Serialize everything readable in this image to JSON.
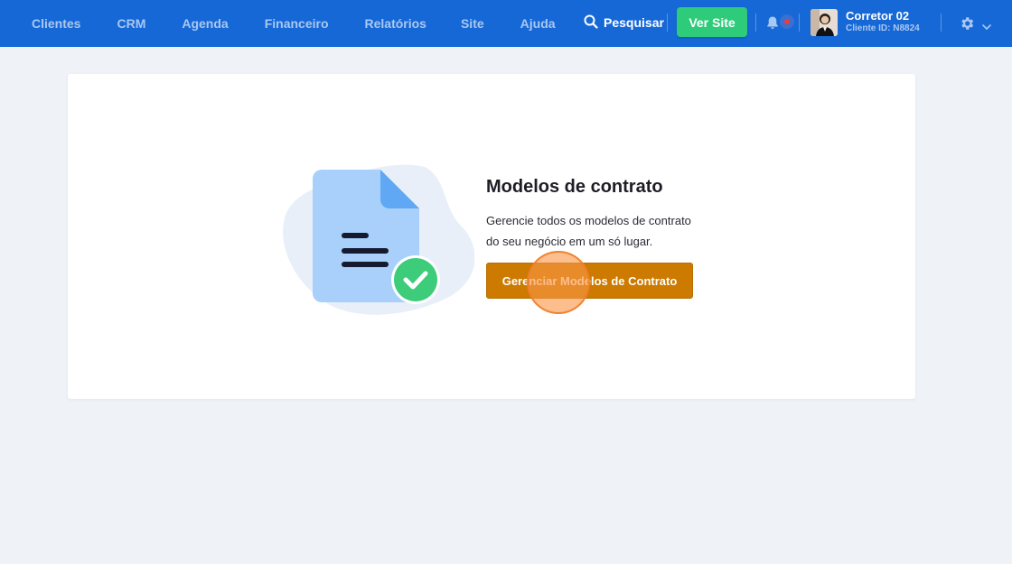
{
  "nav": {
    "items": [
      {
        "label": "Clientes"
      },
      {
        "label": "CRM"
      },
      {
        "label": "Agenda"
      },
      {
        "label": "Financeiro"
      },
      {
        "label": "Relatórios"
      },
      {
        "label": "Site"
      },
      {
        "label": "Ajuda"
      }
    ]
  },
  "header": {
    "search_label": "Pesquisar",
    "ver_site_label": "Ver Site",
    "user_name": "Corretor 02",
    "user_id": "Cliente ID: N8824"
  },
  "icons": {
    "search": "search-icon",
    "bell": "bell-icon",
    "settings": "gear-icon",
    "dropdown": "chevron-down-icon",
    "document": "document-icon",
    "check": "check-circle-icon"
  },
  "colors": {
    "header_bg": "#1668d6",
    "nav_text": "#a9c8f2",
    "ver_site_bg": "#2ecc7a",
    "primary_button": "#cc7a00",
    "page_bg": "#eff3f8",
    "notification_dot": "#ef3b3b"
  },
  "content": {
    "title": "Modelos de contrato",
    "description_line1": "Gerencie todos os modelos de contrato",
    "description_line2": "do seu negócio em um só lugar.",
    "button_label": "Gerenciar Modelos de Contrato"
  }
}
